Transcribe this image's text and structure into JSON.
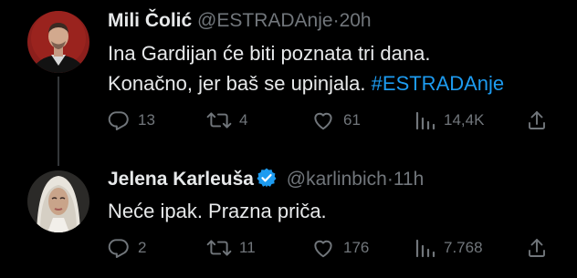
{
  "tweets": [
    {
      "author": {
        "display_name": "Mili Čolić",
        "handle": "@ESTRADAnje",
        "time": "20h",
        "verified": false
      },
      "text_line_1": "Ina Gardijan će biti poznata tri dana.",
      "text_line_2_prefix": "Konačno, jer baš se upinjala.",
      "hashtag": "#ESTRADAnje",
      "actions": {
        "replies": "13",
        "retweets": "4",
        "likes": "61",
        "views": "14,4K"
      }
    },
    {
      "author": {
        "display_name": "Jelena Karleuša",
        "handle": "@karlinbich",
        "time": "11h",
        "verified": true
      },
      "text_line_1": "Neće ipak. Prazna priča.",
      "actions": {
        "replies": "2",
        "retweets": "11",
        "likes": "176",
        "views": "7.768"
      }
    }
  ],
  "ui": {
    "separator": "·",
    "icons": [
      "reply-icon",
      "retweet-icon",
      "like-icon",
      "views-icon",
      "share-icon",
      "verified-badge-icon"
    ]
  },
  "colors": {
    "background": "#000000",
    "text_primary": "#e7e9ea",
    "text_secondary": "#71767b",
    "accent": "#1d9bf0",
    "thread_line": "#333639"
  }
}
